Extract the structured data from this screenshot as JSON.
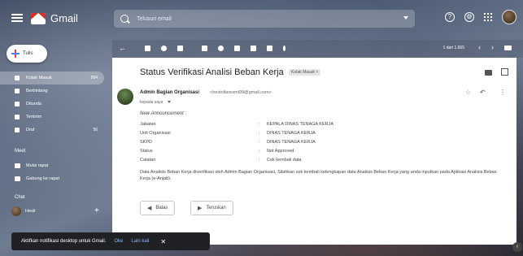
{
  "header": {
    "app_name": "Gmail",
    "search_placeholder": "Telusuri email"
  },
  "sidebar": {
    "compose_label": "Tulis",
    "items": [
      {
        "label": "Kotak Masuk",
        "count": "994"
      },
      {
        "label": "Berbintang",
        "count": ""
      },
      {
        "label": "Ditunda",
        "count": ""
      },
      {
        "label": "Terkirim",
        "count": ""
      },
      {
        "label": "Draf",
        "count": "56"
      }
    ],
    "meet_title": "Meet",
    "meet_items": [
      "Mulai rapat",
      "Gabung ke rapat"
    ],
    "chat_title": "Chat",
    "chat_user": "Hesti"
  },
  "toolbar": {
    "pagination": "1 dari 1.665"
  },
  "message": {
    "subject": "Status Verifikasi Analisi Beban Kerja",
    "label": "Kotak Masuk ×",
    "sender_name": "Admin Bagian Organisasi",
    "sender_email": "<hestoltaresmi99@gmail.com>",
    "recipient": "kepada saya",
    "announcement": "New Announcement :",
    "fields": [
      {
        "label": "Jabatan",
        "value": "KEPALA DINAS TENAGA KERJA"
      },
      {
        "label": "Unit Organisasi",
        "value": "DINAS TENAGA KERJA"
      },
      {
        "label": "SKPD",
        "value": "DINAS TENAGA KERJA"
      },
      {
        "label": "Status",
        "value": "Not Approved"
      },
      {
        "label": "Catatan",
        "value": "Cek kembali data"
      }
    ],
    "body": "Data Analisis Beban Kerja diverifikasi oleh Admin Bagian Organisasi, Silahkan cek kembali kelengkapan data Analisis Beban Kerja yang anda inputkan pada Aplikasi Analisis Beban Kerja (e-Anjab).",
    "reply_label": "Balas",
    "forward_label": "Teruskan"
  },
  "snackbar": {
    "text": "Aktifkan notifikasi desktop untuk Gmail.",
    "ok": "Oke",
    "later": "Lain kali"
  }
}
